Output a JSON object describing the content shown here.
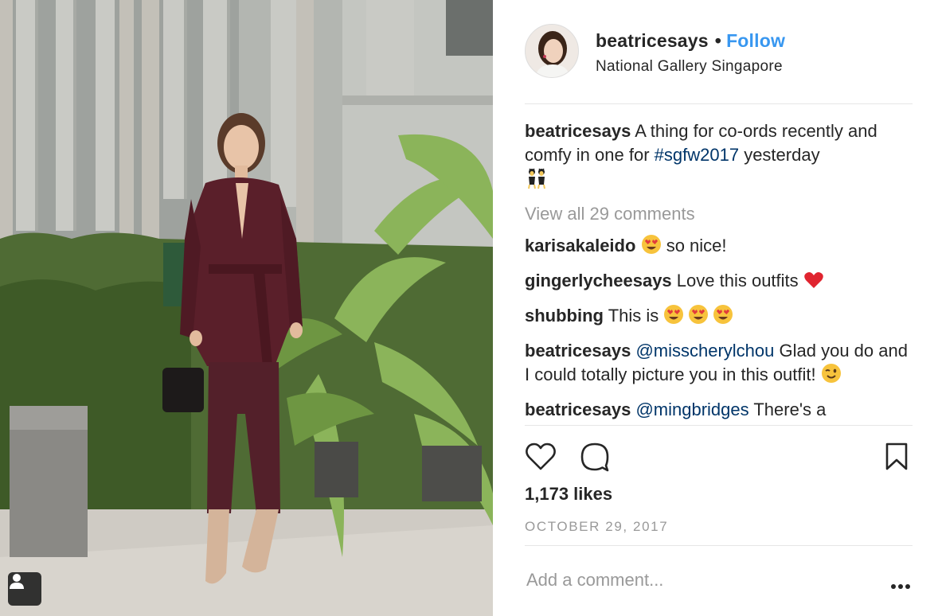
{
  "post": {
    "username": "beatricesays",
    "separator": "•",
    "follow_label": "Follow",
    "location": "National Gallery Singapore"
  },
  "caption": {
    "username": "beatricesays",
    "text_before": "A thing for co-ords recently and comfy in one for",
    "hashtag": "#sgfw2017",
    "text_after": "yesterday",
    "emoji": "dancers"
  },
  "view_all_comments": "View all 29 comments",
  "comments": [
    {
      "username": "karisakaleido",
      "emoji_before": "heart-eyes",
      "text": "so nice!"
    },
    {
      "username": "gingerlycheesays",
      "text": "Love this outfits",
      "emoji_after": "red-heart"
    },
    {
      "username": "shubbing",
      "text": "This is",
      "emoji_after": "heart-eyes x3"
    },
    {
      "username": "beatricesays",
      "mention": "@misscherylchou",
      "text": "Glad you do and I could totally picture you in this outfit!",
      "emoji_after": "wink"
    },
    {
      "username": "beatricesays",
      "mention": "@mingbridges",
      "text": "There's a"
    }
  ],
  "likes": "1,173 likes",
  "date": "OCTOBER 29, 2017",
  "add_comment_placeholder": "Add a comment...",
  "icons": {
    "like": "heart-icon",
    "comment": "speech-bubble-icon",
    "save": "bookmark-icon",
    "more": "ellipsis-icon",
    "user_tag": "user-tag-icon"
  },
  "colors": {
    "link": "#3897f0",
    "hashtag": "#003569",
    "muted": "#999999",
    "text": "#262626"
  }
}
